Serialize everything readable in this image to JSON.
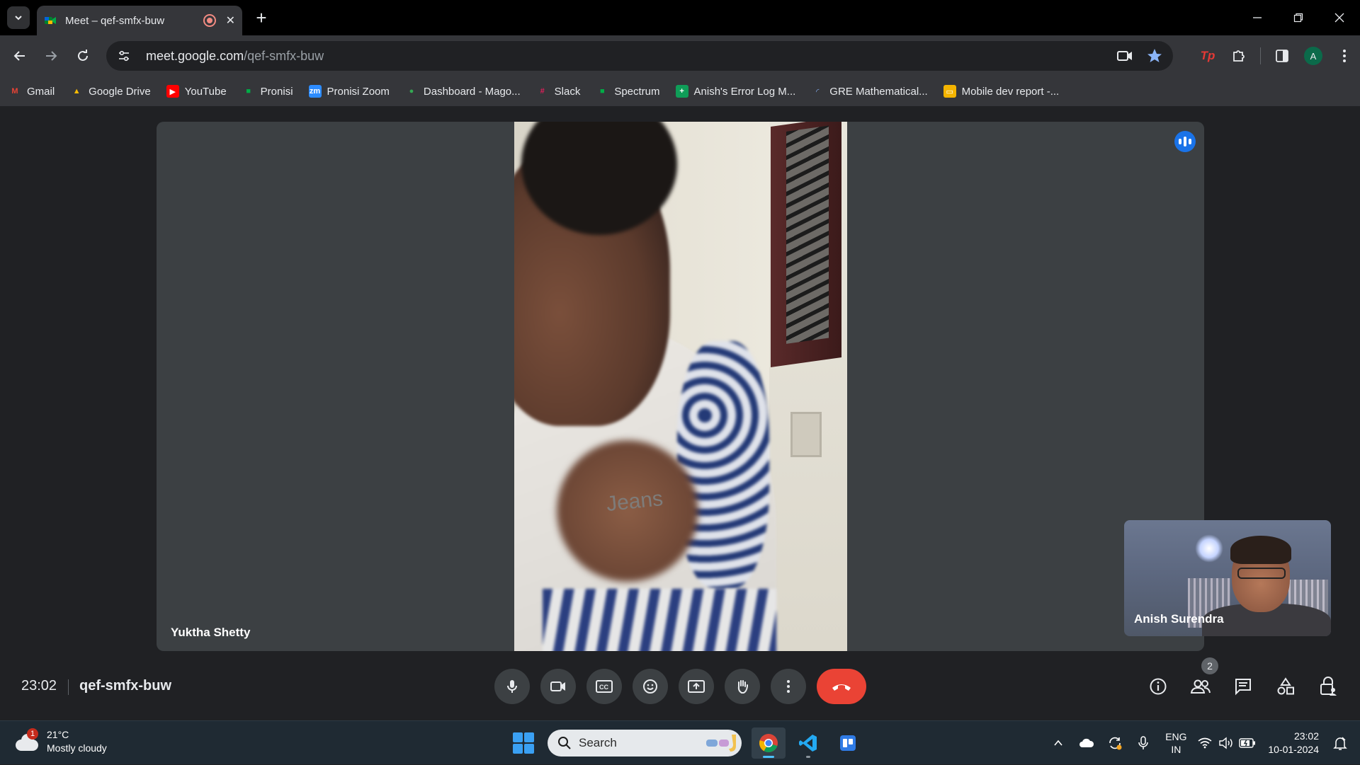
{
  "browser": {
    "tab_title": "Meet – qef-smfx-buw",
    "url_host": "meet.google.com",
    "url_path": "/qef-smfx-buw",
    "profile_initial": "A"
  },
  "bookmarks": [
    {
      "label": "Gmail",
      "icon": "gmail-icon"
    },
    {
      "label": "Google Drive",
      "icon": "drive-icon"
    },
    {
      "label": "YouTube",
      "icon": "youtube-icon"
    },
    {
      "label": "Pronisi",
      "icon": "meet-icon"
    },
    {
      "label": "Pronisi Zoom",
      "icon": "zoom-icon"
    },
    {
      "label": "Dashboard - Mago...",
      "icon": "dashboard-icon"
    },
    {
      "label": "Slack",
      "icon": "slack-icon"
    },
    {
      "label": "Spectrum",
      "icon": "meet-icon"
    },
    {
      "label": "Anish's Error Log M...",
      "icon": "sheets-icon"
    },
    {
      "label": "GRE Mathematical...",
      "icon": "loading-icon"
    },
    {
      "label": "Mobile dev report -...",
      "icon": "slides-icon"
    }
  ],
  "meet": {
    "main_participant": "Yuktha Shetty",
    "self_participant": "Anish Surendra",
    "shirt_text": "Jeans",
    "time": "23:02",
    "meeting_code": "qef-smfx-buw",
    "participant_count": "2"
  },
  "taskbar": {
    "weather_temp": "21°C",
    "weather_desc": "Mostly cloudy",
    "weather_badge": "1",
    "search_placeholder": "Search",
    "lang_line1": "ENG",
    "lang_line2": "IN",
    "clock_time": "23:02",
    "clock_date": "10-01-2024"
  },
  "colors": {
    "end_call": "#ea4335",
    "speaking_indicator": "#1a73e8",
    "stage_bg": "#202124",
    "tile_bg": "#3c4043"
  }
}
